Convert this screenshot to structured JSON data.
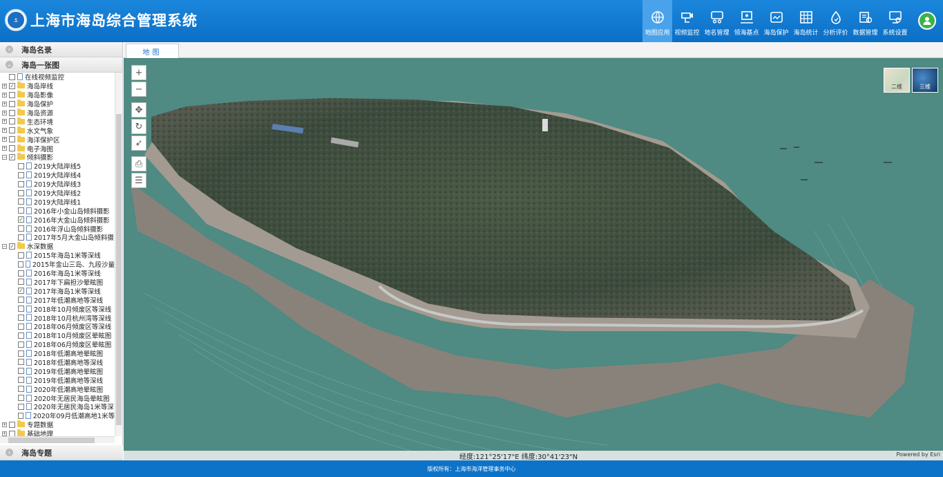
{
  "header": {
    "title": "上海市海岛综合管理系统",
    "nav": [
      {
        "label": "地图应用",
        "icon": "map-globe-icon",
        "active": true
      },
      {
        "label": "视频监控",
        "icon": "camera-icon"
      },
      {
        "label": "地名管理",
        "icon": "place-name-icon"
      },
      {
        "label": "领海基点",
        "icon": "baseline-point-icon"
      },
      {
        "label": "海岛保护",
        "icon": "island-protect-icon"
      },
      {
        "label": "海岛统计",
        "icon": "statistics-icon"
      },
      {
        "label": "分析评价",
        "icon": "analysis-icon"
      },
      {
        "label": "数据管理",
        "icon": "data-manage-icon"
      },
      {
        "label": "系统设置",
        "icon": "settings-icon"
      }
    ]
  },
  "sidebar": {
    "panel_top": "海岛名录",
    "panel_main": "海岛一张图",
    "panel_bottom": "海岛专题",
    "tree": [
      {
        "label": "在线视频监控",
        "level": 0,
        "type": "file",
        "checked": false,
        "expander": ""
      },
      {
        "label": "海岛岸线",
        "level": 0,
        "type": "folder",
        "checked": true,
        "expander": "+"
      },
      {
        "label": "海岛影像",
        "level": 0,
        "type": "folder",
        "checked": false,
        "expander": "+"
      },
      {
        "label": "海岛保护",
        "level": 0,
        "type": "folder",
        "checked": false,
        "expander": "+"
      },
      {
        "label": "海岛资源",
        "level": 0,
        "type": "folder",
        "checked": false,
        "expander": "+"
      },
      {
        "label": "生态环境",
        "level": 0,
        "type": "folder",
        "checked": false,
        "expander": "+"
      },
      {
        "label": "水文气象",
        "level": 0,
        "type": "folder",
        "checked": false,
        "expander": "+"
      },
      {
        "label": "海洋保护区",
        "level": 0,
        "type": "folder",
        "checked": false,
        "expander": "+"
      },
      {
        "label": "电子海图",
        "level": 0,
        "type": "folder",
        "checked": false,
        "expander": "+"
      },
      {
        "label": "倾斜摄影",
        "level": 0,
        "type": "folder",
        "checked": true,
        "expander": "−"
      },
      {
        "label": "2019大陆岸线5",
        "level": 1,
        "type": "file",
        "checked": false
      },
      {
        "label": "2019大陆岸线4",
        "level": 1,
        "type": "file",
        "checked": false
      },
      {
        "label": "2019大陆岸线3",
        "level": 1,
        "type": "file",
        "checked": false
      },
      {
        "label": "2019大陆岸线2",
        "level": 1,
        "type": "file",
        "checked": false
      },
      {
        "label": "2019大陆岸线1",
        "level": 1,
        "type": "file",
        "checked": false
      },
      {
        "label": "2016年小金山岛倾斜摄影",
        "level": 1,
        "type": "file",
        "checked": false
      },
      {
        "label": "2016年大金山岛倾斜摄影",
        "level": 1,
        "type": "file",
        "checked": true
      },
      {
        "label": "2016年浮山岛倾斜摄影",
        "level": 1,
        "type": "file",
        "checked": false
      },
      {
        "label": "2017年5月大金山岛倾斜摄",
        "level": 1,
        "type": "file",
        "checked": false
      },
      {
        "label": "水深数据",
        "level": 0,
        "type": "folder",
        "checked": true,
        "expander": "−"
      },
      {
        "label": "2015年海岛1米等深线",
        "level": 1,
        "type": "file",
        "checked": false
      },
      {
        "label": "2015年金山三岛、九段沙量",
        "level": 1,
        "type": "file",
        "checked": false
      },
      {
        "label": "2016年海岛1米等深线",
        "level": 1,
        "type": "file",
        "checked": false
      },
      {
        "label": "2017年下扁担沙晕眩图",
        "level": 1,
        "type": "file",
        "checked": false
      },
      {
        "label": "2017年海岛1米等深线",
        "level": 1,
        "type": "file",
        "checked": true
      },
      {
        "label": "2017年低潮高地等深线",
        "level": 1,
        "type": "file",
        "checked": false
      },
      {
        "label": "2018年10月倾废区等深线",
        "level": 1,
        "type": "file",
        "checked": false
      },
      {
        "label": "2018年10月杭州湾等深线",
        "level": 1,
        "type": "file",
        "checked": false
      },
      {
        "label": "2018年06月倾废区等深线",
        "level": 1,
        "type": "file",
        "checked": false
      },
      {
        "label": "2018年10月倾废区晕眩图",
        "level": 1,
        "type": "file",
        "checked": false
      },
      {
        "label": "2018年06月倾废区晕眩图",
        "level": 1,
        "type": "file",
        "checked": false
      },
      {
        "label": "2018年低潮高地晕眩图",
        "level": 1,
        "type": "file",
        "checked": false
      },
      {
        "label": "2018年低潮高地等深线",
        "level": 1,
        "type": "file",
        "checked": false
      },
      {
        "label": "2019年低潮高地晕眩图",
        "level": 1,
        "type": "file",
        "checked": false
      },
      {
        "label": "2019年低潮高地等深线",
        "level": 1,
        "type": "file",
        "checked": false
      },
      {
        "label": "2020年低潮高地晕眩图",
        "level": 1,
        "type": "file",
        "checked": false
      },
      {
        "label": "2020年无居民海岛晕眩图",
        "level": 1,
        "type": "file",
        "checked": false
      },
      {
        "label": "2020年无居民海岛1米等深",
        "level": 1,
        "type": "file",
        "checked": false
      },
      {
        "label": "2020年09月低潮高地1米等",
        "level": 1,
        "type": "file",
        "checked": false
      },
      {
        "label": "专题数据",
        "level": 0,
        "type": "folder",
        "checked": false,
        "expander": "+"
      },
      {
        "label": "基础地理",
        "level": 0,
        "type": "folder",
        "checked": false,
        "expander": "+"
      }
    ]
  },
  "main": {
    "tab_label": "地图",
    "map": {
      "basemap_2d": "二维",
      "basemap_3d": "三维",
      "coordinates": "经度:121°25'17\"E 纬度:30°41'23\"N",
      "attribution": "Powered by Esri",
      "tools": [
        {
          "name": "zoom-in-button",
          "glyph": "+"
        },
        {
          "name": "zoom-out-button",
          "glyph": "−"
        },
        {
          "name": "pan-button",
          "glyph": "✥"
        },
        {
          "name": "rotate-button",
          "glyph": "↻"
        },
        {
          "name": "compass-button",
          "glyph": "➶"
        },
        {
          "name": "print-button",
          "glyph": "⎙"
        },
        {
          "name": "layer-list-button",
          "glyph": "☰"
        }
      ]
    }
  },
  "footer": {
    "copyright": "版权所有：上海市海洋管理事务中心"
  },
  "colors": {
    "header_blue": "#0b6fc6",
    "active_nav": "#4aa2ea",
    "sea": "#4f8a83",
    "avatar_green": "#3cb34a"
  }
}
